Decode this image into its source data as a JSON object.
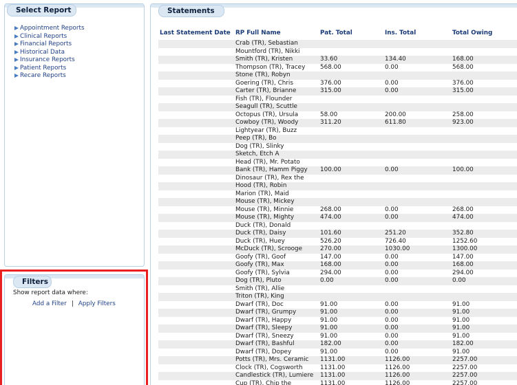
{
  "select_report": {
    "title": "Select Report",
    "items": [
      "Appointment Reports",
      "Clinical Reports",
      "Financial Reports",
      "Historical Data",
      "Insurance Reports",
      "Patient Reports",
      "Recare Reports"
    ]
  },
  "filters": {
    "title": "Filters",
    "description": "Show report data where:",
    "add_filter": "Add a Filter",
    "separator": "|",
    "apply_filters": "Apply Filters"
  },
  "statements": {
    "title": "Statements",
    "columns": [
      "Last Statement Date",
      "RP Full Name",
      "Pat. Total",
      "Ins. Total",
      "Total Owing"
    ],
    "rows": [
      [
        "",
        "Crab (TR), Sebastian",
        "",
        "",
        ""
      ],
      [
        "",
        "Mountford (TR), Nikki",
        "",
        "",
        ""
      ],
      [
        "",
        "Smith (TR), Kristen",
        "33.60",
        "134.40",
        "168.00"
      ],
      [
        "",
        "Thompson (TR), Tracey",
        "568.00",
        "0.00",
        "568.00"
      ],
      [
        "",
        "Stone (TR), Robyn",
        "",
        "",
        ""
      ],
      [
        "",
        "Goering (TR), Chris",
        "376.00",
        "0.00",
        "376.00"
      ],
      [
        "",
        "Carter (TR), Brianne",
        "315.00",
        "0.00",
        "315.00"
      ],
      [
        "",
        "Fish (TR), Flounder",
        "",
        "",
        ""
      ],
      [
        "",
        "Seagull (TR), Scuttle",
        "",
        "",
        ""
      ],
      [
        "",
        "Octopus (TR), Ursula",
        "58.00",
        "200.00",
        "258.00"
      ],
      [
        "",
        "Cowboy (TR), Woody",
        "311.20",
        "611.80",
        "923.00"
      ],
      [
        "",
        "Lightyear (TR), Buzz",
        "",
        "",
        ""
      ],
      [
        "",
        "Peep (TR), Bo",
        "",
        "",
        ""
      ],
      [
        "",
        "Dog (TR), Slinky",
        "",
        "",
        ""
      ],
      [
        "",
        "Sketch, Etch A",
        "",
        "",
        ""
      ],
      [
        "",
        "Head (TR), Mr. Potato",
        "",
        "",
        ""
      ],
      [
        "",
        "Bank (TR), Hamm Piggy",
        "100.00",
        "0.00",
        "100.00"
      ],
      [
        "",
        "Dinosaur (TR), Rex the",
        "",
        "",
        ""
      ],
      [
        "",
        "Hood (TR), Robin",
        "",
        "",
        ""
      ],
      [
        "",
        "Marion (TR), Maid",
        "",
        "",
        ""
      ],
      [
        "",
        "Mouse (TR), Mickey",
        "",
        "",
        ""
      ],
      [
        "",
        "Mouse (TR), Minnie",
        "268.00",
        "0.00",
        "268.00"
      ],
      [
        "",
        "Mouse (TR), Mighty",
        "474.00",
        "0.00",
        "474.00"
      ],
      [
        "",
        "Duck (TR), Donald",
        "",
        "",
        ""
      ],
      [
        "",
        "Duck (TR), Daisy",
        "101.60",
        "251.20",
        "352.80"
      ],
      [
        "",
        "Duck (TR), Huey",
        "526.20",
        "726.40",
        "1252.60"
      ],
      [
        "",
        "McDuck (TR), Scrooge",
        "270.00",
        "1030.00",
        "1300.00"
      ],
      [
        "",
        "Goofy (TR), Goof",
        "147.00",
        "0.00",
        "147.00"
      ],
      [
        "",
        "Goofy (TR), Max",
        "168.00",
        "0.00",
        "168.00"
      ],
      [
        "",
        "Goofy (TR), Sylvia",
        "294.00",
        "0.00",
        "294.00"
      ],
      [
        "",
        "Dog (TR), Pluto",
        "0.00",
        "0.00",
        "0.00"
      ],
      [
        "",
        "Smith (TR), Allie",
        "",
        "",
        ""
      ],
      [
        "",
        "Triton (TR), King",
        "",
        "",
        ""
      ],
      [
        "",
        "Dwarf (TR), Doc",
        "91.00",
        "0.00",
        "91.00"
      ],
      [
        "",
        "Dwarf (TR), Grumpy",
        "91.00",
        "0.00",
        "91.00"
      ],
      [
        "",
        "Dwarf (TR), Happy",
        "91.00",
        "0.00",
        "91.00"
      ],
      [
        "",
        "Dwarf (TR), Sleepy",
        "91.00",
        "0.00",
        "91.00"
      ],
      [
        "",
        "Dwarf (TR), Sneezy",
        "91.00",
        "0.00",
        "91.00"
      ],
      [
        "",
        "Dwarf (TR), Bashful",
        "182.00",
        "0.00",
        "182.00"
      ],
      [
        "",
        "Dwarf (TR), Dopey",
        "91.00",
        "0.00",
        "91.00"
      ],
      [
        "",
        "Potts (TR), Mrs. Ceramic",
        "1131.00",
        "1126.00",
        "2257.00"
      ],
      [
        "",
        "Clock (TR), Cogsworth",
        "1131.00",
        "1126.00",
        "2257.00"
      ],
      [
        "",
        "Candlestick (TR), Lumiere",
        "1131.00",
        "1126.00",
        "2257.00"
      ],
      [
        "",
        "Cup (TR), Chip the",
        "1131.00",
        "1126.00",
        "2257.00"
      ]
    ]
  },
  "colors": {
    "panel_border": "#b7cfe5",
    "tab_background": "#dbe7f3",
    "link": "#1f3f86",
    "highlight_outline": "#ea1f1f",
    "row_stripe": "#ececec"
  },
  "icons": {
    "report_item": "triangle-right-icon"
  }
}
